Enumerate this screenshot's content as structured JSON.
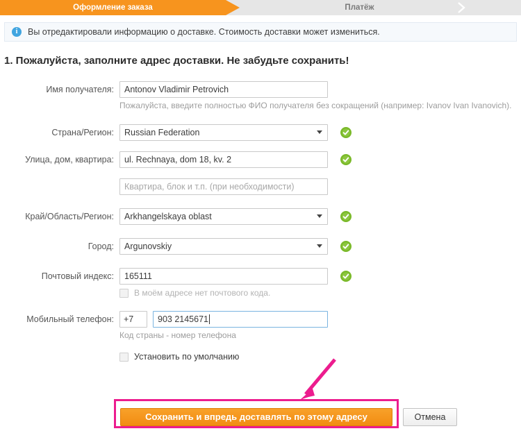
{
  "steps": {
    "active": "Оформление заказа",
    "next": "Платёж"
  },
  "banner": {
    "icon": "info-icon",
    "icon_glyph": "i",
    "text": "Вы отредактировали информацию о доставке. Стоимость доставки может измениться."
  },
  "heading": "1. Пожалуйста, заполните адрес доставки. Не забудьте сохранить!",
  "form": {
    "recipient": {
      "label": "Имя получателя:",
      "value": "Antonov Vladimir Petrovich",
      "hint": "Пожалуйста, введите полностью ФИО получателя без сокращений (например: Ivanov Ivan Ivanovich).",
      "valid_icon": "check-circle-icon"
    },
    "country": {
      "label": "Страна/Регион:",
      "value": "Russian Federation",
      "valid_icon": "check-circle-icon"
    },
    "street": {
      "label": "Улица, дом, квартира:",
      "value": "ul. Rechnaya, dom 18, kv. 2",
      "valid_icon": "check-circle-icon"
    },
    "apartment": {
      "placeholder": "Квартира, блок и т.п. (при необходимости)",
      "value": ""
    },
    "region": {
      "label": "Край/Область/Регион:",
      "value": "Arkhangelskaya oblast",
      "valid_icon": "check-circle-icon"
    },
    "city": {
      "label": "Город:",
      "value": "Argunovskiy",
      "valid_icon": "check-circle-icon"
    },
    "postcode": {
      "label": "Почтовый индекс:",
      "value": "165111",
      "valid_icon": "check-circle-icon",
      "no_postcode_checkbox": "В моём адресе нет почтового кода."
    },
    "phone": {
      "label": "Мобильный телефон:",
      "country_code": "+7",
      "number": "903 2145671",
      "hint": "Код страны - номер телефона"
    },
    "default_checkbox": "Установить по умолчанию"
  },
  "footer": {
    "save_label": "Сохранить и впредь доставлять по этому адресу",
    "cancel_label": "Отмена"
  },
  "annotation": {
    "arrow": "arrow-pointing-to-save-button",
    "highlight": "save-button-highlight-box",
    "color": "#ec1c8e"
  },
  "colors": {
    "accent_orange": "#f7941e",
    "valid_green": "#7ab929",
    "info_blue": "#41a5e0",
    "annotation_pink": "#ec1c8e"
  }
}
